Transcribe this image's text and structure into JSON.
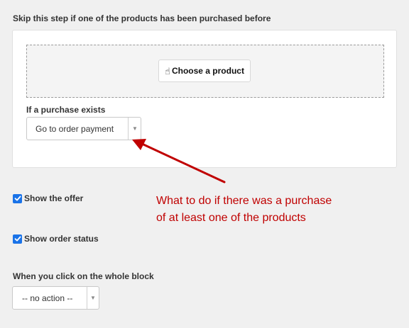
{
  "skip_section": {
    "title": "Skip this step if one of the products has been purchased before",
    "choose_button": {
      "icon": "hand-pointer-icon",
      "label": "Choose a product"
    },
    "purchase_exists": {
      "label": "If a purchase exists",
      "selected": "Go to order payment"
    }
  },
  "options": {
    "show_offer": {
      "label": "Show the offer",
      "checked": true
    },
    "show_order_status": {
      "label": "Show order status",
      "checked": true
    }
  },
  "click_block": {
    "label": "When you click on the whole block",
    "selected": "-- no action --"
  },
  "annotation": {
    "line1": "What to do if there was a purchase",
    "line2": "of at least one of the products",
    "color": "#c00000"
  },
  "colors": {
    "accent": "#1a73e8",
    "annotation": "#c00000"
  }
}
